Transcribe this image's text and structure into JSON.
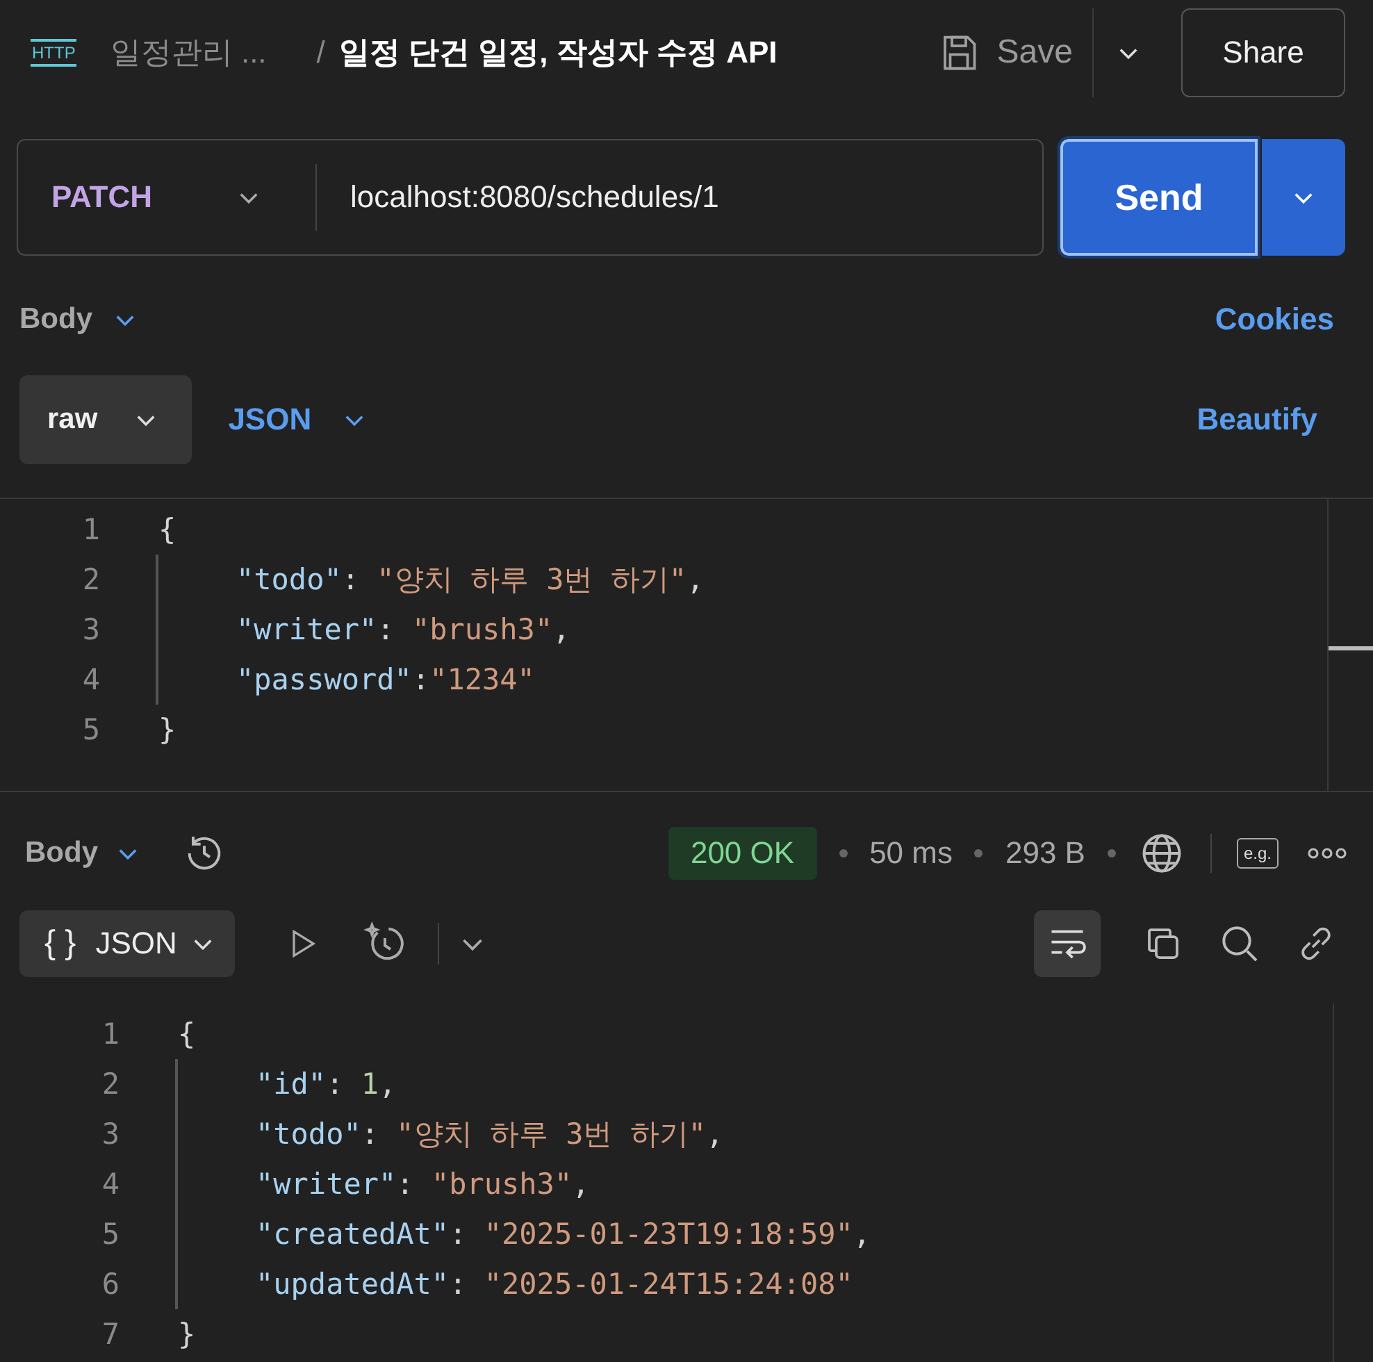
{
  "header": {
    "protocol_icon": "HTTP",
    "collection": "일정관리 ...",
    "separator": "/",
    "title": "일정 단건 일정, 작성자 수정 API",
    "save": "Save",
    "share": "Share"
  },
  "request": {
    "method": "PATCH",
    "url": "localhost:8080/schedules/1",
    "send": "Send"
  },
  "body_bar": {
    "label": "Body",
    "cookies": "Cookies"
  },
  "body_options": {
    "mode": "raw",
    "format": "JSON",
    "beautify": "Beautify"
  },
  "request_body": [
    {
      "number": "1",
      "indented": false,
      "tokens": [
        {
          "kind": "punct",
          "text": "{"
        }
      ]
    },
    {
      "number": "2",
      "indented": true,
      "tokens": [
        {
          "kind": "key",
          "text": "\"todo\""
        },
        {
          "kind": "punct",
          "text": ": "
        },
        {
          "kind": "string",
          "text": "\"양치 하루 3번 하기\""
        },
        {
          "kind": "punct",
          "text": ","
        }
      ]
    },
    {
      "number": "3",
      "indented": true,
      "tokens": [
        {
          "kind": "key",
          "text": "\"writer\""
        },
        {
          "kind": "punct",
          "text": ": "
        },
        {
          "kind": "string",
          "text": "\"brush3\""
        },
        {
          "kind": "punct",
          "text": ","
        }
      ]
    },
    {
      "number": "4",
      "indented": true,
      "tokens": [
        {
          "kind": "key",
          "text": "\"password\""
        },
        {
          "kind": "punct",
          "text": ":"
        },
        {
          "kind": "string",
          "text": "\"1234\""
        }
      ]
    },
    {
      "number": "5",
      "indented": false,
      "tokens": [
        {
          "kind": "punct",
          "text": "}"
        }
      ]
    }
  ],
  "response_bar": {
    "label": "Body",
    "status": "200 OK",
    "time": "50 ms",
    "size": "293 B",
    "example": "e.g."
  },
  "response_toolbar": {
    "format_icon": "{ }",
    "format": "JSON"
  },
  "response_body": [
    {
      "number": "1",
      "indented": false,
      "tokens": [
        {
          "kind": "punct",
          "text": "{"
        }
      ]
    },
    {
      "number": "2",
      "indented": true,
      "tokens": [
        {
          "kind": "key",
          "text": "\"id\""
        },
        {
          "kind": "punct",
          "text": ": "
        },
        {
          "kind": "number",
          "text": "1"
        },
        {
          "kind": "punct",
          "text": ","
        }
      ]
    },
    {
      "number": "3",
      "indented": true,
      "tokens": [
        {
          "kind": "key",
          "text": "\"todo\""
        },
        {
          "kind": "punct",
          "text": ": "
        },
        {
          "kind": "string",
          "text": "\"양치 하루 3번 하기\""
        },
        {
          "kind": "punct",
          "text": ","
        }
      ]
    },
    {
      "number": "4",
      "indented": true,
      "tokens": [
        {
          "kind": "key",
          "text": "\"writer\""
        },
        {
          "kind": "punct",
          "text": ": "
        },
        {
          "kind": "string",
          "text": "\"brush3\""
        },
        {
          "kind": "punct",
          "text": ","
        }
      ]
    },
    {
      "number": "5",
      "indented": true,
      "tokens": [
        {
          "kind": "key",
          "text": "\"createdAt\""
        },
        {
          "kind": "punct",
          "text": ": "
        },
        {
          "kind": "string",
          "text": "\"2025-01-23T19:18:59\""
        },
        {
          "kind": "punct",
          "text": ","
        }
      ]
    },
    {
      "number": "6",
      "indented": true,
      "tokens": [
        {
          "kind": "key",
          "text": "\"updatedAt\""
        },
        {
          "kind": "punct",
          "text": ": "
        },
        {
          "kind": "string",
          "text": "\"2025-01-24T15:24:08\""
        }
      ]
    },
    {
      "number": "7",
      "indented": false,
      "tokens": [
        {
          "kind": "punct",
          "text": "}"
        }
      ]
    }
  ]
}
